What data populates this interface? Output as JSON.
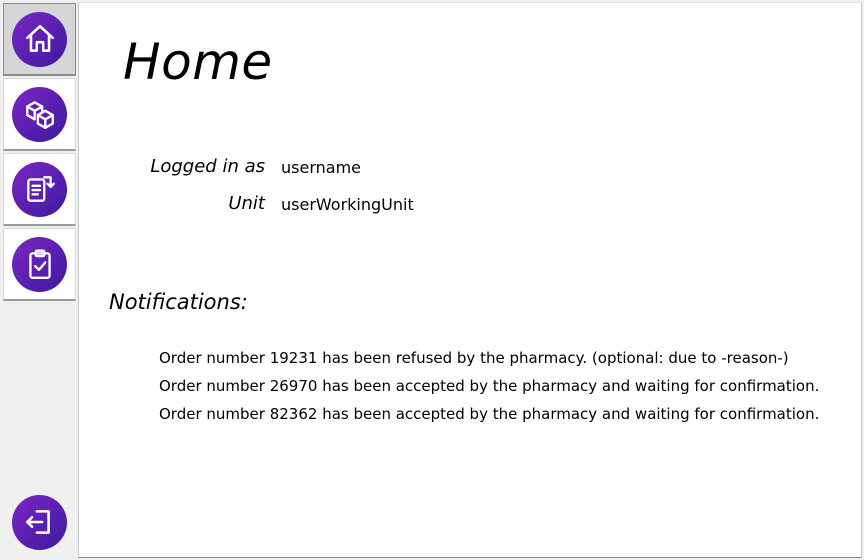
{
  "sidebar": {
    "items": [
      {
        "icon": "home-icon",
        "active": true
      },
      {
        "icon": "boxes-icon",
        "active": false
      },
      {
        "icon": "document-transfer-icon",
        "active": false
      },
      {
        "icon": "clipboard-check-icon",
        "active": false
      }
    ],
    "logout_icon": "logout-icon",
    "icon_color": "#5a1fb0"
  },
  "main": {
    "title": "Home",
    "user_info": {
      "logged_in_label": "Logged in as",
      "logged_in_value": "username",
      "unit_label": "Unit",
      "unit_value": "userWorkingUnit"
    },
    "notifications": {
      "title": "Notifications:",
      "items": [
        "Order number 19231 has been refused by the pharmacy. (optional: due to -reason-)",
        "Order number 26970 has been accepted by the pharmacy and waiting for confirmation.",
        "Order number 82362 has been accepted by the pharmacy and waiting for confirmation."
      ]
    }
  }
}
